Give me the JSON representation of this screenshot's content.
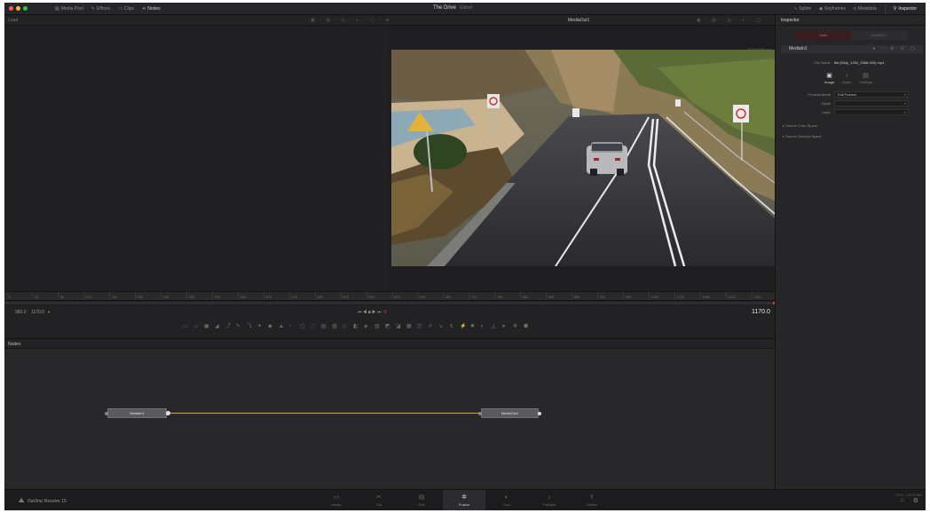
{
  "topbar": {
    "window_controls": {
      "colors": [
        "#fe5f57",
        "#febc2e",
        "#28c840"
      ]
    },
    "left_items": [
      {
        "icon": "media-pool-icon",
        "label": "Media Pool"
      },
      {
        "icon": "effects-icon",
        "label": "Effects"
      },
      {
        "icon": "clips-icon",
        "label": "Clips"
      },
      {
        "icon": "nodes-icon",
        "label": "Nodes",
        "active": true
      }
    ],
    "project_title": "The Drive",
    "project_subtitle": "Edited",
    "right_items": [
      {
        "icon": "spline-icon",
        "label": "Spline"
      },
      {
        "icon": "keyframes-icon",
        "label": "Keyframes"
      },
      {
        "icon": "metadata-icon",
        "label": "Metadata"
      },
      {
        "icon": "inspector-icon",
        "label": "Inspector",
        "active": true
      }
    ]
  },
  "viewer_bar": {
    "left_label": "Load",
    "viewer_title": "MediaOut1"
  },
  "viewer": {
    "resolution": "1920x1080 xyz"
  },
  "timeline": {
    "ruler_ticks": [
      "0",
      "40",
      "80",
      "120",
      "160",
      "200",
      "240",
      "280",
      "320",
      "360",
      "400",
      "440",
      "480",
      "520",
      "560",
      "600",
      "640",
      "680",
      "720",
      "760",
      "800",
      "840",
      "880",
      "920",
      "960",
      "1000",
      "1040",
      "1080",
      "1120",
      "1160"
    ],
    "playhead_color": "#cc3a3a"
  },
  "transport": {
    "start_frame": "960.0",
    "end_frame": "1170.0",
    "controls": "⏮ ◀ ■ ▶ ⏭",
    "timecode": "1170.0"
  },
  "nodes_panel": {
    "title": "Nodes",
    "node_in": "MediaIn1",
    "node_out": "MediaOut1",
    "link_color": "#d6a828"
  },
  "inspector": {
    "title": "Inspector",
    "tabs": [
      {
        "label": "Tools",
        "active": true
      },
      {
        "label": "Modifiers",
        "active": false
      }
    ],
    "node_name": "MediaIn1",
    "clip_name_label": "Clip Name",
    "clip_name_value": "file:(Dfdp_1262_0068.000).mp4",
    "subtabs": [
      {
        "icon": "image-icon",
        "label": "Image",
        "active": true
      },
      {
        "icon": "audio-icon",
        "label": "Audio",
        "active": false
      },
      {
        "icon": "settings-icon",
        "label": "Settings",
        "active": false
      }
    ],
    "process_mode_label": "Process Mode",
    "process_mode_value": "Full Frames",
    "depth_label": "Depth",
    "layer_label": "Layer",
    "sections": [
      "Source Color Space",
      "Source Gamma Space"
    ]
  },
  "bottombar": {
    "app_name": "DaVinci Resolve 15",
    "pages": [
      {
        "icon": "media-page-icon",
        "label": "Media",
        "glyph": "▭"
      },
      {
        "icon": "cut-page-icon",
        "label": "Cut",
        "glyph": "✂"
      },
      {
        "icon": "edit-page-icon",
        "label": "Edit",
        "glyph": "▤"
      },
      {
        "icon": "fusion-page-icon",
        "label": "Fusion",
        "glyph": "✲",
        "active": true
      },
      {
        "icon": "color-page-icon",
        "label": "Color",
        "glyph": "◐"
      },
      {
        "icon": "fairlight-page-icon",
        "label": "Fairlight",
        "glyph": "♪"
      },
      {
        "icon": "deliver-page-icon",
        "label": "Deliver",
        "glyph": "⇪"
      }
    ],
    "meta": "20% - 133.6 MiB"
  }
}
